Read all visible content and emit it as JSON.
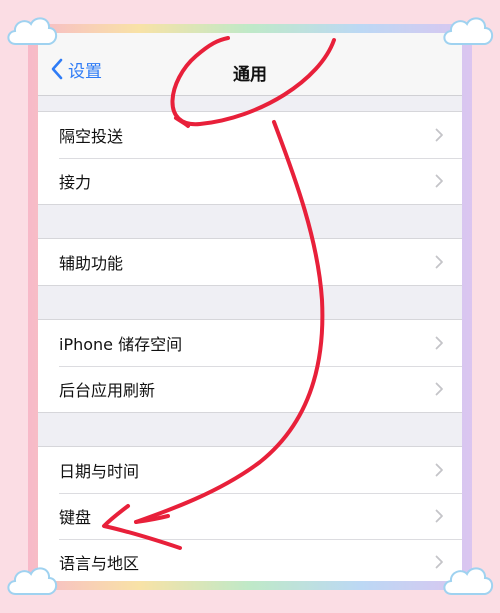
{
  "navbar": {
    "back_label": "设置",
    "title": "通用"
  },
  "groups": [
    {
      "items": [
        {
          "label": "隔空投送"
        },
        {
          "label": "接力"
        }
      ]
    },
    {
      "items": [
        {
          "label": "辅助功能"
        }
      ]
    },
    {
      "items": [
        {
          "label": "iPhone 储存空间"
        },
        {
          "label": "后台应用刷新"
        }
      ]
    },
    {
      "items": [
        {
          "label": "日期与时间"
        },
        {
          "label": "键盘"
        },
        {
          "label": "语言与地区"
        }
      ]
    }
  ],
  "colors": {
    "accent": "#2f7cf6",
    "annotation": "#e8203a",
    "background": "#fbdde4"
  },
  "icons": {
    "back": "chevron-left-icon",
    "row": "chevron-right-icon",
    "corner": "cloud-icon"
  }
}
